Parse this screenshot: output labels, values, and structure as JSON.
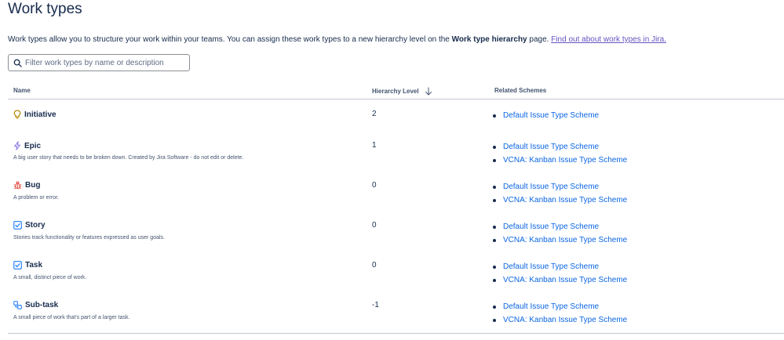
{
  "page": {
    "title": "Work types",
    "intro_text": "Work types allow you to structure your work within your teams. You can assign these work types to a new hierarchy level on the ",
    "intro_bold": "Work type hierarchy",
    "intro_after": " page. ",
    "intro_link": "Find out about work types in Jira."
  },
  "search": {
    "placeholder": "Filter work types by name or description",
    "value": ""
  },
  "table": {
    "headers": {
      "name": "Name",
      "hierarchy": "Hierarchy Level",
      "schemes": "Related Schemes"
    },
    "rows": [
      {
        "name": "Initiative",
        "description": "",
        "level": "2",
        "icon": "lightbulb-icon",
        "schemes": [
          "Default Issue Type Scheme"
        ]
      },
      {
        "name": "Epic",
        "description": "A big user story that needs to be broken down. Created by Jira Software - do not edit or delete.",
        "level": "1",
        "icon": "lightning-icon",
        "schemes": [
          "Default Issue Type Scheme",
          "VCNA: Kanban Issue Type Scheme"
        ]
      },
      {
        "name": "Bug",
        "description": "A problem or error.",
        "level": "0",
        "icon": "bug-icon",
        "schemes": [
          "Default Issue Type Scheme",
          "VCNA: Kanban Issue Type Scheme"
        ]
      },
      {
        "name": "Story",
        "description": "Stories track functionality or features expressed as user goals.",
        "level": "0",
        "icon": "story-icon",
        "schemes": [
          "Default Issue Type Scheme",
          "VCNA: Kanban Issue Type Scheme"
        ]
      },
      {
        "name": "Task",
        "description": "A small, distinct piece of work.",
        "level": "0",
        "icon": "task-checkbox-icon",
        "schemes": [
          "Default Issue Type Scheme",
          "VCNA: Kanban Issue Type Scheme"
        ]
      },
      {
        "name": "Sub-task",
        "description": "A small piece of work that's part of a larger task.",
        "level": "-1",
        "icon": "subtask-icon",
        "schemes": [
          "Default Issue Type Scheme",
          "VCNA: Kanban Issue Type Scheme"
        ]
      }
    ]
  },
  "colors": {
    "link": "#0c66e4",
    "visited_link": "#6554c0",
    "initiative": "#b38600",
    "epic": "#8f7ee7",
    "bug": "#e2483d",
    "task": "#1d7afc"
  }
}
